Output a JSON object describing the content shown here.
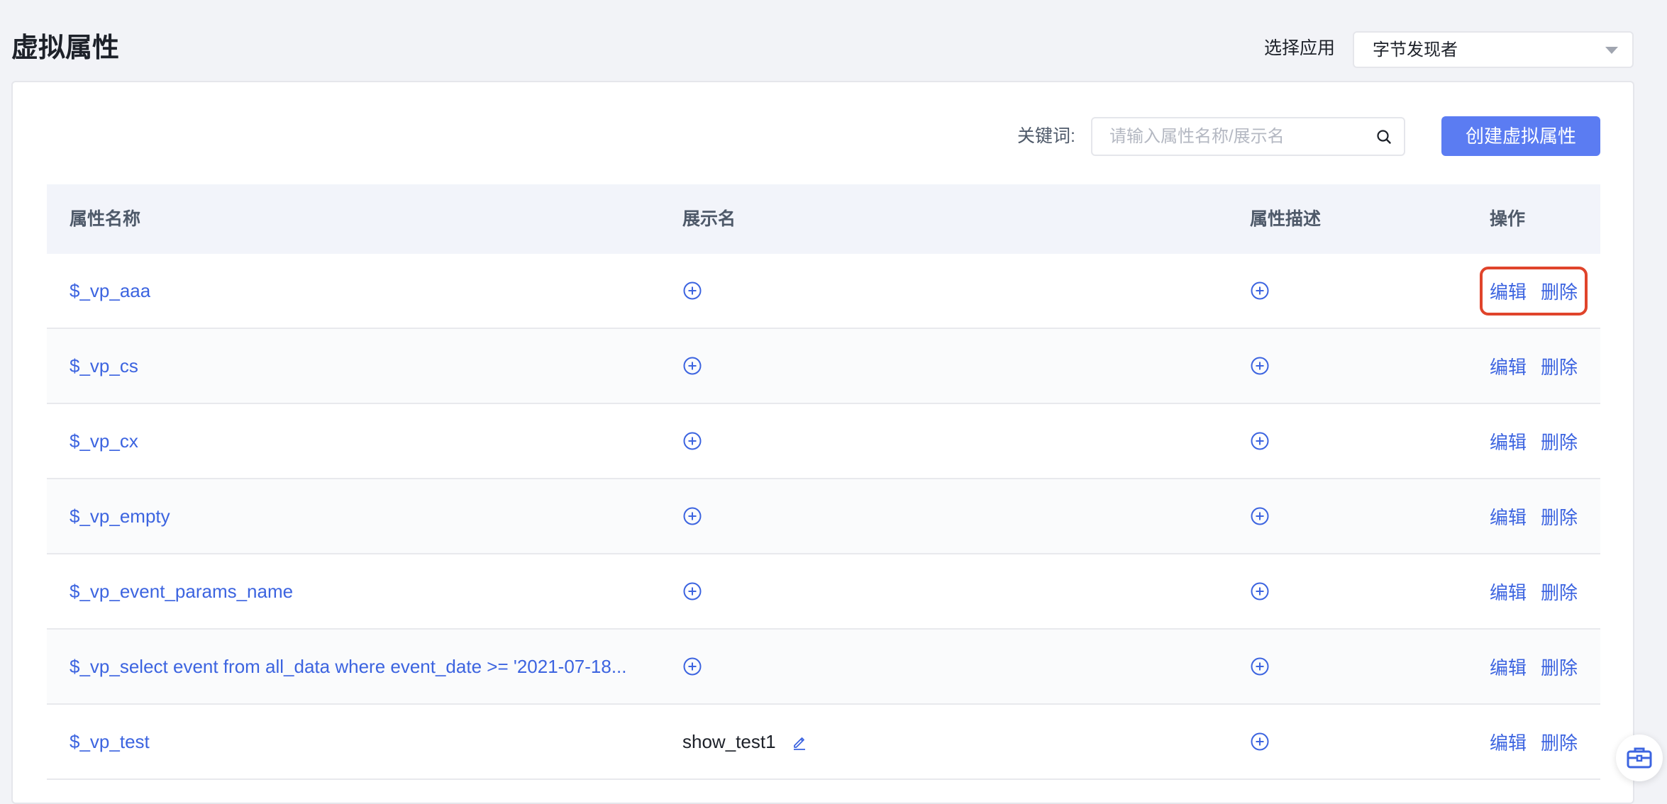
{
  "page": {
    "title": "虚拟属性"
  },
  "app_select": {
    "label": "选择应用",
    "value": "字节发现者"
  },
  "search": {
    "label": "关键词:",
    "placeholder": "请输入属性名称/展示名"
  },
  "create_button": {
    "label": "创建虚拟属性"
  },
  "table": {
    "columns": [
      "属性名称",
      "展示名",
      "属性描述",
      "操作"
    ],
    "actions": {
      "edit": "编辑",
      "delete": "删除"
    },
    "rows": [
      {
        "name": "$_vp_aaa",
        "display_name": "",
        "description": ""
      },
      {
        "name": "$_vp_cs",
        "display_name": "",
        "description": ""
      },
      {
        "name": "$_vp_cx",
        "display_name": "",
        "description": ""
      },
      {
        "name": "$_vp_empty",
        "display_name": "",
        "description": ""
      },
      {
        "name": "$_vp_event_params_name",
        "display_name": "",
        "description": ""
      },
      {
        "name": "$_vp_select event from all_data where event_date >= '2021-07-18...",
        "display_name": "",
        "description": ""
      },
      {
        "name": "$_vp_test",
        "display_name": "show_test1",
        "description": ""
      }
    ]
  },
  "colors": {
    "accent": "#5b7cf2",
    "link": "#3c64e0",
    "highlight": "#e0442b"
  },
  "icons": [
    "chevron-down-icon",
    "search-icon",
    "plus-circle-icon",
    "pencil-icon",
    "toolbox-icon"
  ]
}
